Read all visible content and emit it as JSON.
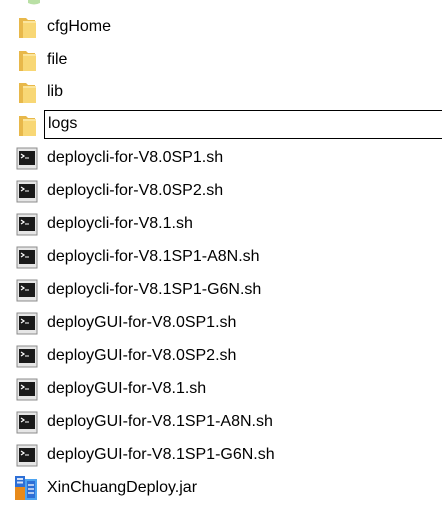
{
  "file_list": {
    "items": [
      {
        "name": "cfgHome",
        "type": "folder",
        "icon": "folder-icon"
      },
      {
        "name": "file",
        "type": "folder",
        "icon": "folder-icon"
      },
      {
        "name": "lib",
        "type": "folder",
        "icon": "folder-icon"
      },
      {
        "name": "logs",
        "type": "folder",
        "icon": "folder-icon",
        "renaming": true
      },
      {
        "name": "deploycli-for-V8.0SP1.sh",
        "type": "script",
        "icon": "shell-script-icon"
      },
      {
        "name": "deploycli-for-V8.0SP2.sh",
        "type": "script",
        "icon": "shell-script-icon"
      },
      {
        "name": "deploycli-for-V8.1.sh",
        "type": "script",
        "icon": "shell-script-icon"
      },
      {
        "name": "deploycli-for-V8.1SP1-A8N.sh",
        "type": "script",
        "icon": "shell-script-icon"
      },
      {
        "name": "deploycli-for-V8.1SP1-G6N.sh",
        "type": "script",
        "icon": "shell-script-icon"
      },
      {
        "name": "deployGUI-for-V8.0SP1.sh",
        "type": "script",
        "icon": "shell-script-icon"
      },
      {
        "name": "deployGUI-for-V8.0SP2.sh",
        "type": "script",
        "icon": "shell-script-icon"
      },
      {
        "name": "deployGUI-for-V8.1.sh",
        "type": "script",
        "icon": "shell-script-icon"
      },
      {
        "name": "deployGUI-for-V8.1SP1-A8N.sh",
        "type": "script",
        "icon": "shell-script-icon"
      },
      {
        "name": "deployGUI-for-V8.1SP1-G6N.sh",
        "type": "script",
        "icon": "shell-script-icon"
      },
      {
        "name": "XinChuangDeploy.jar",
        "type": "archive",
        "icon": "archive-icon"
      }
    ]
  },
  "colors": {
    "folder_front": "#f8d775",
    "folder_back": "#e8b84a",
    "terminal_frame": "#8c8c8c",
    "terminal_screen": "#1a1a1a",
    "archive_blue": "#2e6fd6",
    "archive_orange": "#e88a1a"
  }
}
